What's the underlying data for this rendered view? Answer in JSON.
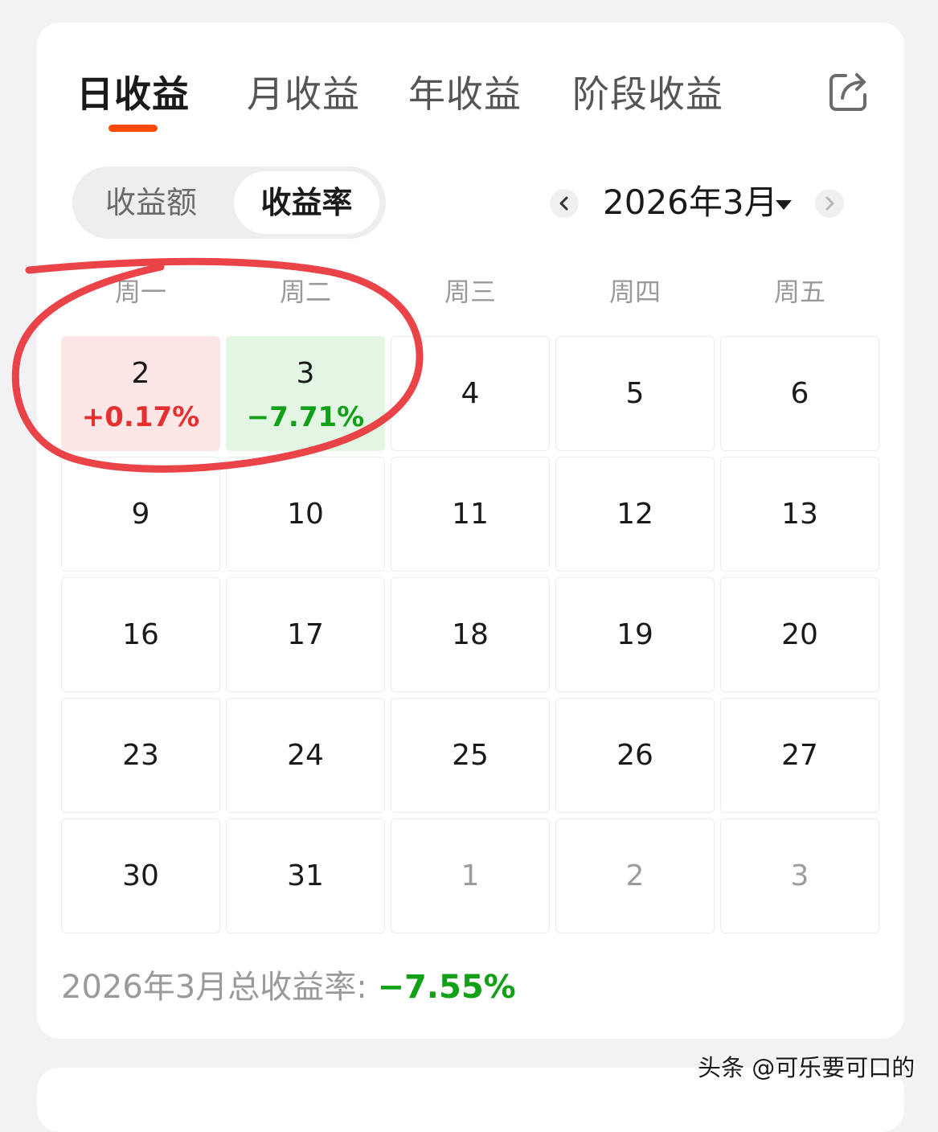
{
  "tabs": [
    {
      "label": "日收益",
      "active": true
    },
    {
      "label": "月收益",
      "active": false
    },
    {
      "label": "年收益",
      "active": false
    },
    {
      "label": "阶段收益",
      "active": false
    }
  ],
  "share_icon": "share-export-icon",
  "segment": {
    "options": [
      {
        "label": "收益额",
        "selected": false
      },
      {
        "label": "收益率",
        "selected": true
      }
    ]
  },
  "month_nav": {
    "label": "2026年3月",
    "prev_icon": "chevron-left-icon",
    "next_icon": "chevron-right-icon",
    "dropdown_icon": "caret-down-icon"
  },
  "weekdays": [
    "周一",
    "周二",
    "周三",
    "周四",
    "周五"
  ],
  "calendar": {
    "rows": [
      [
        {
          "day": "2",
          "value": "+0.17%",
          "trend": "up"
        },
        {
          "day": "3",
          "value": "−7.71%",
          "trend": "down"
        },
        {
          "day": "4"
        },
        {
          "day": "5"
        },
        {
          "day": "6"
        }
      ],
      [
        {
          "day": "9"
        },
        {
          "day": "10"
        },
        {
          "day": "11"
        },
        {
          "day": "12"
        },
        {
          "day": "13"
        }
      ],
      [
        {
          "day": "16"
        },
        {
          "day": "17"
        },
        {
          "day": "18"
        },
        {
          "day": "19"
        },
        {
          "day": "20"
        }
      ],
      [
        {
          "day": "23"
        },
        {
          "day": "24"
        },
        {
          "day": "25"
        },
        {
          "day": "26"
        },
        {
          "day": "27"
        }
      ],
      [
        {
          "day": "30"
        },
        {
          "day": "31"
        },
        {
          "day": "1",
          "other_month": true
        },
        {
          "day": "2",
          "other_month": true
        },
        {
          "day": "3",
          "other_month": true
        }
      ]
    ]
  },
  "summary": {
    "label": "2026年3月总收益率: ",
    "value": "−7.55%"
  },
  "colors": {
    "accent": "#ff4a0c",
    "gain": "#e43030",
    "loss": "#11a016",
    "annotation": "#e8343a"
  },
  "watermark": "头条 @可乐要可口的"
}
